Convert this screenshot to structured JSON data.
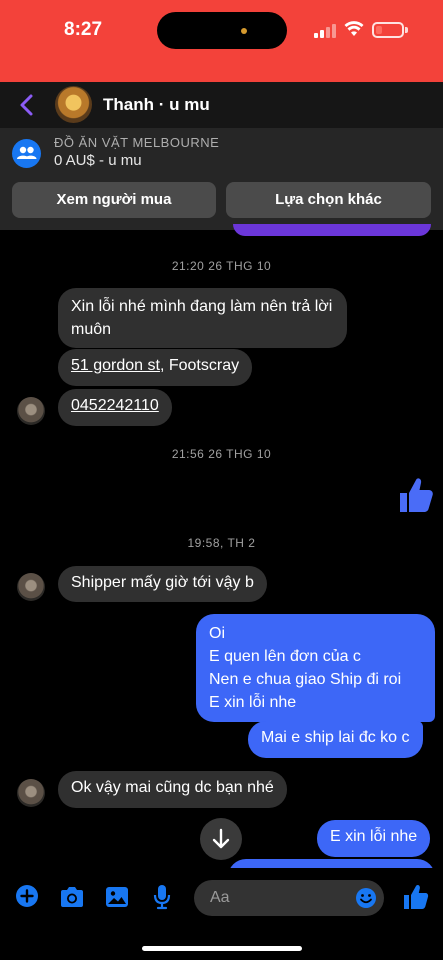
{
  "status_bar": {
    "time": "8:27",
    "bg_color": "#f3423a"
  },
  "header": {
    "contact_name": "Thanh · u mu",
    "accent_color": "#7c4dff"
  },
  "listing": {
    "title": "ĐỒ ĂN VẶT MELBOURNE",
    "price": "0 AU$ - u mu",
    "buttons": [
      "Xem người mua",
      "Lựa chọn khác"
    ]
  },
  "messages": {
    "ts1": "21:20 26 THG 10",
    "m1": "Xin lỗi nhé mình đang làm nên trả lời muôn",
    "m2_link": "51 gordon st",
    "m2_rest": ", Footscray",
    "m3": "0452242110",
    "ts2": "21:56 26 THG 10",
    "ts3": "19:58, TH 2",
    "m4": "Shipper mấy giờ tới vậy b",
    "m5_lines": [
      "Oi",
      "E quen lên đơn của c",
      "Nen e chua giao Ship đi roi",
      "E xin lỗi nhe"
    ],
    "m6": "Mai e ship lai đc ko c",
    "m7": "Ok vậy mai cũng dc bạn nhé",
    "m8": "E xin lỗi nhe"
  },
  "composer": {
    "placeholder": "Aa"
  },
  "colors": {
    "outgoing_bubble": "#3d67f7",
    "incoming_bubble": "#303030",
    "messenger_blue": "#1877f2"
  },
  "icons": [
    "back-arrow-icon",
    "group-icon",
    "like-icon",
    "arrow-down-icon",
    "plus-icon",
    "camera-icon",
    "photo-icon",
    "microphone-icon",
    "emoji-icon"
  ]
}
